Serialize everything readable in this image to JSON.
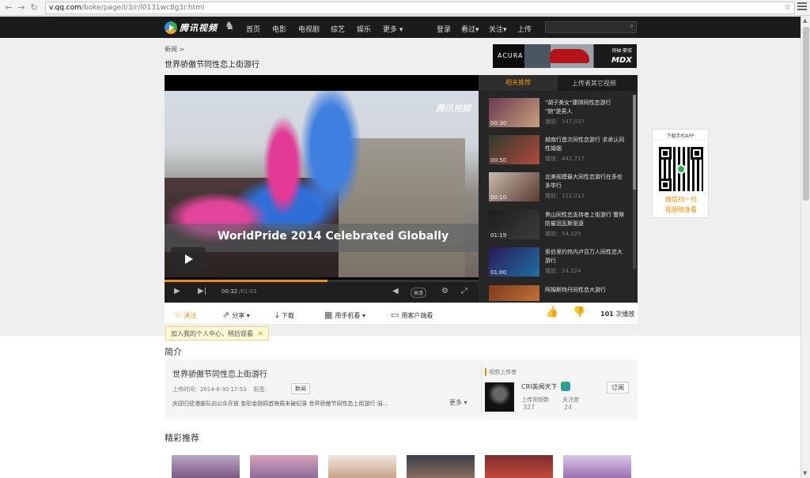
{
  "browser": {
    "url_host": "v.qq.com",
    "url_path": "/boke/page/l/3/r/l0131wc8g3r.html"
  },
  "topnav": {
    "logo_text": "腾讯视频",
    "items": [
      "首页",
      "电影",
      "电视剧",
      "综艺",
      "娱乐",
      "更多"
    ],
    "right_items": [
      "登录",
      "看过",
      "关注",
      "上传"
    ]
  },
  "crumb": "新闻 >",
  "page_title": "世界骄傲节同性恋上街游行",
  "ad": {
    "brand": "ACURA",
    "tag": "领袖·豪驭",
    "model": "MDX"
  },
  "player": {
    "watermark": "腾讯视频",
    "caption": "WorldPride 2014 Celebrated Globally",
    "time_current": "00:32",
    "time_duration": "/01:03",
    "quality": "高清",
    "progress": 0.52
  },
  "side": {
    "tab_active": "相关推荐",
    "tab_other": "上传者其它视频",
    "items": [
      {
        "title": "\"胡子美女\"康琪同性恋游行 \"她\"是男人",
        "plays": "播放：147,037",
        "duration": "00:30",
        "c1": "#6b3a52",
        "c2": "#c7a07a"
      },
      {
        "title": "越南行首次同性恋游行 求承认同性婚姻",
        "plays": "播放：442,717",
        "duration": "00:50",
        "c1": "#2f3a2c",
        "c2": "#b04a3d"
      },
      {
        "title": "北美规模最大同性恋游行在多伦多举行",
        "plays": "播放：111,012",
        "duration": "00:10",
        "c1": "#c9b9ae",
        "c2": "#5a3a30"
      },
      {
        "title": "黑山同性恋支持者上街游行 警察防催泪瓦斯驱逐",
        "plays": "播放：54,329",
        "duration": "01:19",
        "c1": "#1d1d1d",
        "c2": "#3c3c3c"
      },
      {
        "title": "索伯里约热内卢百万人同性恋大游行",
        "plays": "播放：24,224",
        "duration": "01:00",
        "c1": "#2a1a5a",
        "c2": "#1f6fa0"
      },
      {
        "title": "阿姆斯特丹同性恋大游行",
        "plays": "",
        "duration": "",
        "c1": "#7a3d1e",
        "c2": "#d07a3a"
      }
    ]
  },
  "actions": {
    "follow": "关注",
    "share": "分享",
    "download": "下载",
    "mobile": "用手机看",
    "client": "用客户端看",
    "plays_count": "101",
    "plays_label": "次播放"
  },
  "tooltip": "加入我的个人中心，稍后观看",
  "intro": {
    "heading": "简介",
    "video_title": "世界骄傲节同性恋上街游行",
    "upload_time": "上传时间：2014-6-30 17:53",
    "tag_label": "标签：",
    "tag": "新闻",
    "desc": "庆回归驻港部队向公众开放 变形金刚四首映周末破纪录 世界骄傲节同性恋上街游行 涓...",
    "more": "更多",
    "uploader_heading": "视频上传者",
    "uploader_name": "CRI英闻天下",
    "subscribe": "订阅",
    "stat1_label": "上传视频数",
    "stat1_value": "327",
    "stat2_label": "关注度",
    "stat2_value": "24"
  },
  "featured_heading": "精彩推荐",
  "qr": {
    "head": "下载手机APP",
    "line1": "微信扫一扫",
    "line2": "视频随身看"
  },
  "colors": {
    "accent": "#f18d00",
    "nav_bg": "#1b1b1b"
  }
}
